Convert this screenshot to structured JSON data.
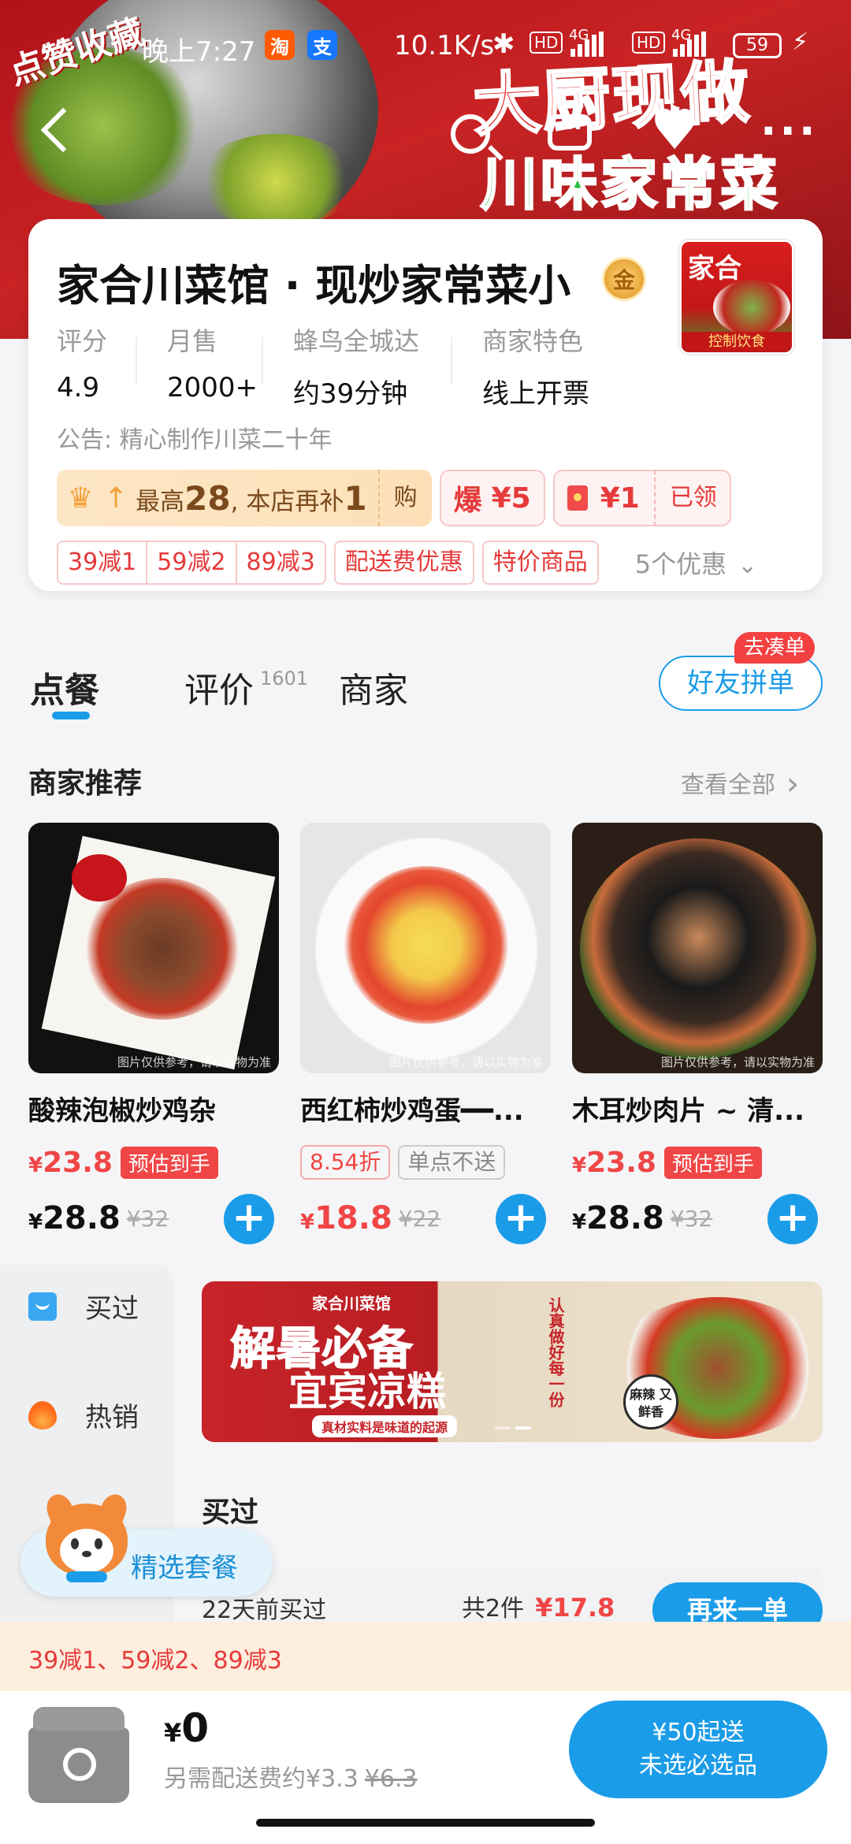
{
  "status_bar": {
    "time": "晚上7:27",
    "app1": "淘",
    "app2": "支",
    "net_speed": "10.1K/s",
    "hd": "HD",
    "network": "4G",
    "battery": "59"
  },
  "hero": {
    "corner_text": "点赞收藏",
    "title": "大厨现做",
    "subtitle": "川味家常菜"
  },
  "store": {
    "name": "家合川菜馆 · 现炒家常菜小",
    "medal": "金",
    "logo_text": "家合",
    "logo_bottom": "控制饮食",
    "stats": [
      {
        "label": "评分",
        "value": "4.9"
      },
      {
        "label": "月售",
        "value": "2000+"
      },
      {
        "label": "蜂鸟全城达",
        "value": "约39分钟"
      },
      {
        "label": "商家特色",
        "value": "线上开票"
      }
    ],
    "notice": "公告: 精心制作川菜二十年",
    "promo": {
      "prefix": "最高",
      "max": "28",
      "mid": ", 本店再补",
      "extra": "1",
      "buy": "购",
      "bao": "爆",
      "bao_amount": "¥5",
      "red_amount": "¥1",
      "claimed": "已领"
    },
    "coupons_group": [
      "39减1",
      "59减2",
      "89减3"
    ],
    "coupons": [
      "配送费优惠",
      "特价商品"
    ],
    "coupon_more": "5个优惠"
  },
  "tabs": {
    "order": "点餐",
    "reviews": "评价",
    "reviews_count": "1601",
    "merchant": "商家",
    "group_btn": "好友拼单",
    "group_badge": "去凑单"
  },
  "recommend": {
    "title": "商家推荐",
    "more": "查看全部",
    "img_note": "图片仅供参考，请以实物为准",
    "items": [
      {
        "name": "酸辣泡椒炒鸡杂",
        "est_price": "23.8",
        "est_tag": "预估到手",
        "price": "28.8",
        "old": "¥32",
        "add": "+"
      },
      {
        "name": "西红柿炒鸡蛋━━...",
        "discount": "8.54折",
        "no_single": "单点不送",
        "price": "18.8",
        "old": "¥22",
        "add": "+"
      },
      {
        "name": "木耳炒肉片 ~ 清...",
        "est_price": "23.8",
        "est_tag": "预估到手",
        "price": "28.8",
        "old": "¥32",
        "add": "+"
      }
    ]
  },
  "sidebar": {
    "items": [
      {
        "label": "买过"
      },
      {
        "label": "热销"
      }
    ]
  },
  "banner": {
    "tag": "家合川菜馆",
    "main1": "解暑必备",
    "main2": "宜宾凉糕",
    "strip": "真材实料是味道的起源",
    "vertical": "认真做好每一份",
    "badge": "麻辣 又鲜香"
  },
  "section": {
    "title": "买过",
    "ago": "22天前买过",
    "total_label": "共2件",
    "total_price": "¥17.8",
    "again": "再来一单"
  },
  "combo": {
    "label": "精选套餐"
  },
  "discount_strip": "39减1、59减2、89减3",
  "cart": {
    "currency": "¥",
    "price": "0",
    "fee_text": "另需配送费约¥3.3",
    "fee_old": "¥6.3",
    "checkout_line1": "¥50起送",
    "checkout_line2": "未选必选品"
  },
  "colors": {
    "accent": "#1b9ce8",
    "price_red": "#f04646",
    "hero_red": "#c92324"
  }
}
